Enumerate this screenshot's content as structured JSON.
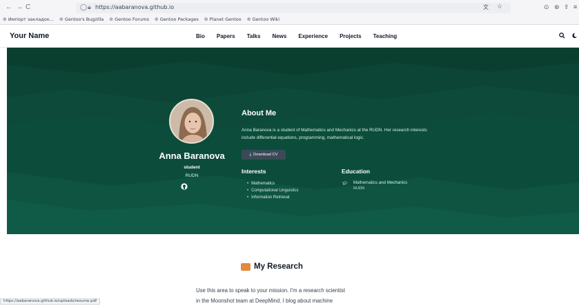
{
  "browser": {
    "back_icon": "←",
    "forward_icon": "→",
    "reload_icon": "C",
    "url": "https://aabaranova.github.io",
    "translate_icon": "translate-icon",
    "star_icon": "☆",
    "right_icons": [
      "⊙",
      "⊛",
      "⇪",
      "≡"
    ],
    "bookmarks": [
      {
        "label": "Импорт закладок..."
      },
      {
        "label": "Gentoo's Bugzilla"
      },
      {
        "label": "Gentoo Forums"
      },
      {
        "label": "Gentoo Packages"
      },
      {
        "label": "Planet Gentoo"
      },
      {
        "label": "Gentoo Wiki"
      }
    ],
    "status_url": "https://aabaranova.github.io/uploads/resume.pdf"
  },
  "site": {
    "brand": "Your Name",
    "menu": [
      "Bio",
      "Papers",
      "Talks",
      "News",
      "Experience",
      "Projects",
      "Teaching"
    ],
    "search_icon": "search-icon",
    "theme_icon": "theme-icon"
  },
  "colors": {
    "hero_bg": "#0b4d3a",
    "button_bg": "#3b4a57"
  },
  "profile": {
    "name": "Anna Baranova",
    "role": "student",
    "org": "RUDN",
    "social_icons": [
      "email-icon",
      "github-icon"
    ]
  },
  "about": {
    "title": "About Me",
    "text": "Anna Baranova is a student of Mathematics and Mechanics at the RUDN. Her research interests include differential equations, programming, mathematical logic.",
    "cv_button": "Download CV"
  },
  "interests": {
    "title": "Interests",
    "items": [
      "Mathematics",
      "Computational Linguistics",
      "Information Retrieval"
    ]
  },
  "education": {
    "title": "Education",
    "items": [
      {
        "degree": "Mathematics and Mechanics",
        "institution": "RUDN"
      }
    ]
  },
  "research": {
    "title": "My Research",
    "paragraph_lines": [
      "Use this area to speak to your mission. I'm a research scientist",
      "in the Moonshot team at DeepMind. I blog about machine"
    ]
  }
}
